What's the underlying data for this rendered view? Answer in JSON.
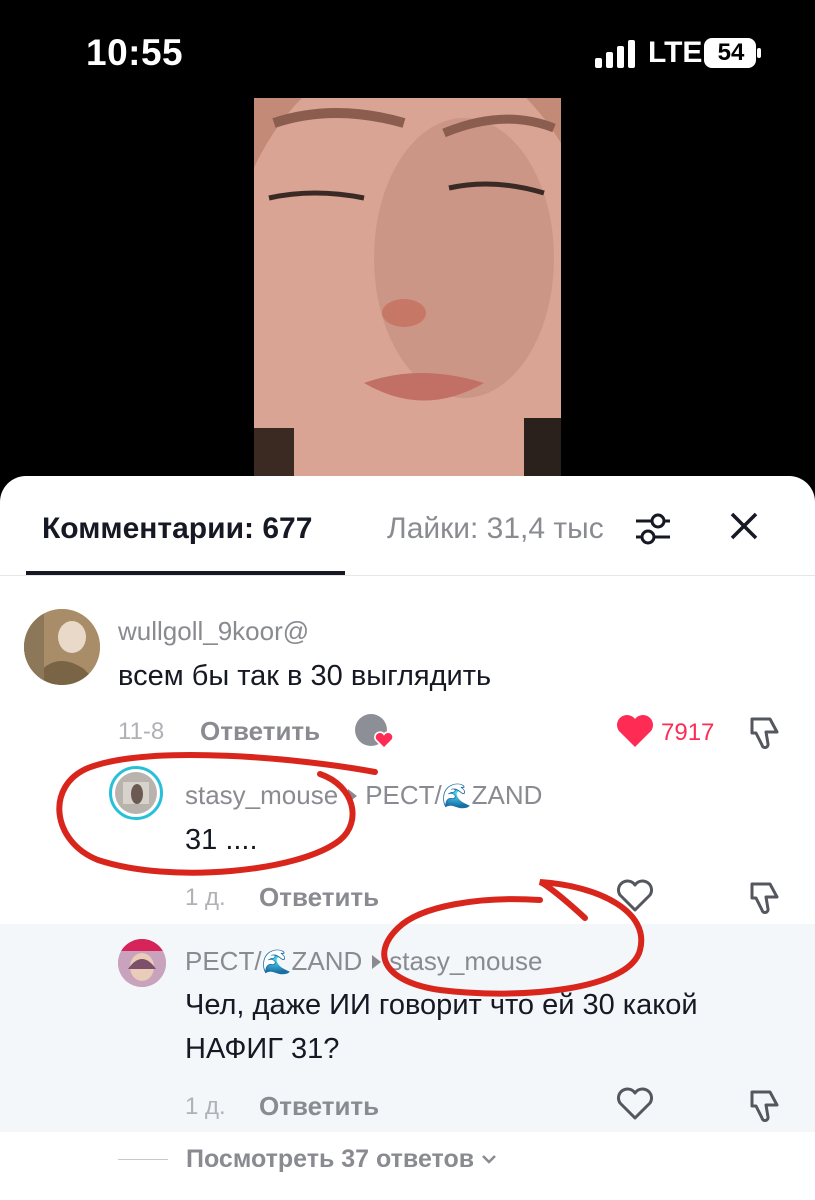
{
  "status": {
    "time": "10:55",
    "network": "LTE",
    "battery": "54"
  },
  "sheet": {
    "tabs": {
      "comments": "Комментарии: 677",
      "likes": "Лайки: 31,4 тыс."
    }
  },
  "comments": [
    {
      "username": "wullgoll_9koor@",
      "text": "всем бы так в 30 выглядить",
      "date": "11-8",
      "reply_label": "Ответить",
      "likes": "7917",
      "liked": true
    },
    {
      "username": "stasy_mouse",
      "reply_to": "PECT/",
      "reply_to_suffix": "ZAND",
      "text": "31 ....",
      "date": "1 д.",
      "reply_label": "Ответить"
    },
    {
      "username": "PECT/",
      "username_suffix": "ZAND",
      "reply_to": "stasy_mouse",
      "text_line1": "Чел, даже ИИ говорит что ей 30 какой",
      "text_line2": "НАФИГ 31?",
      "date": "1 д.",
      "reply_label": "Ответить"
    }
  ],
  "view_more": "Посмотреть 37 ответов",
  "icons": {
    "wave": "🌊",
    "accent_like": "#fe2c55",
    "annotation_color": "#d9261c"
  }
}
